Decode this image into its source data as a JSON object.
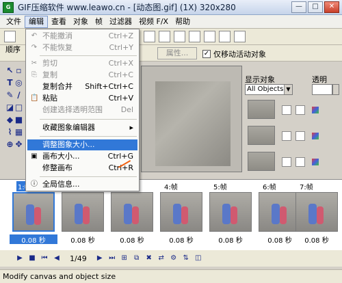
{
  "window": {
    "title": "GIF压缩软件 www.leawo.cn - [动态图.gif] (1X) 320x280",
    "min_symbol": "—",
    "max_symbol": "□",
    "close_symbol": "✕"
  },
  "menubar": {
    "items": [
      "文件",
      "编辑",
      "查看",
      "对象",
      "帧",
      "过滤器",
      "视频 F/X",
      "帮助"
    ]
  },
  "edit_menu": {
    "items": [
      {
        "label": "不能撤消",
        "shortcut": "Ctrl+Z",
        "icon": "↶",
        "disabled": true
      },
      {
        "label": "不能恢复",
        "shortcut": "Ctrl+Y",
        "icon": "↷",
        "disabled": true
      },
      {
        "label": "剪切",
        "shortcut": "Ctrl+X",
        "icon": "✂",
        "disabled": true
      },
      {
        "label": "复制",
        "shortcut": "Ctrl+C",
        "icon": "⎘",
        "disabled": true
      },
      {
        "label": "复制合并",
        "shortcut": "Shift+Ctrl+C",
        "icon": "",
        "disabled": false
      },
      {
        "label": "粘贴",
        "shortcut": "Ctrl+V",
        "icon": "📋",
        "disabled": false
      },
      {
        "label": "创建选择透明范围",
        "shortcut": "Del",
        "icon": "",
        "disabled": true
      },
      {
        "label": "收藏图象编辑器",
        "shortcut": "▸",
        "icon": "",
        "disabled": false
      },
      {
        "label": "调整图象大小...",
        "shortcut": "",
        "icon": "",
        "disabled": false,
        "highlight": true
      },
      {
        "label": "画布大小...",
        "shortcut": "Ctrl+G",
        "icon": "▣",
        "disabled": false
      },
      {
        "label": "修整画布",
        "shortcut": "Ctrl+R",
        "icon": "",
        "disabled": false
      },
      {
        "label": "全局信息...",
        "shortcut": "",
        "icon": "ⓘ",
        "disabled": false
      }
    ]
  },
  "toolbar": {
    "sequence_label": "顺序",
    "properties_label": "属性...",
    "move_active_label": "仅移动活动对象",
    "move_active_checked": "✓"
  },
  "right_panel": {
    "show_objects_label": "显示对象",
    "transparency_label": "透明",
    "objects_select": "All Objects"
  },
  "frames": [
    {
      "label": "1:帧",
      "delay": "0.08 秒",
      "selected": true
    },
    {
      "label": "",
      "delay": "0.08 秒",
      "selected": false
    },
    {
      "label": "",
      "delay": "0.08 秒",
      "selected": false
    },
    {
      "label": "4:帧",
      "delay": "0.08 秒",
      "selected": false
    },
    {
      "label": "5:帧",
      "delay": "0.08 秒",
      "selected": false
    },
    {
      "label": "6:帧",
      "delay": "0.08 秒",
      "selected": false
    },
    {
      "label": "7:帧",
      "delay": "0.08 秒",
      "selected": false
    }
  ],
  "playbar": {
    "counter": "1/49"
  },
  "status": {
    "text": "Modify canvas and object size"
  }
}
